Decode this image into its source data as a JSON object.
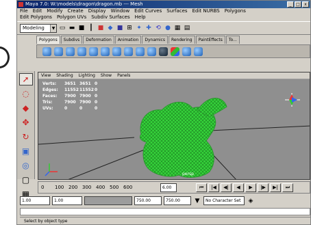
{
  "window": {
    "title": "Maya 7.0: W:\\models\\dragon\\dragon.mb --- Mesh",
    "min": "_",
    "max": "□",
    "close": "x"
  },
  "menus": {
    "row1": [
      "File",
      "Edit",
      "Modify",
      "Create",
      "Display",
      "Window",
      "Edit Curves",
      "Surfaces",
      "Edit NURBS",
      "Polygons"
    ],
    "row2": [
      "Edit Polygons",
      "Polygon UVs",
      "Subdiv Surfaces",
      "Help"
    ]
  },
  "status": {
    "mode": "Modeling",
    "mode_arrow": "▼"
  },
  "shelf": {
    "tabs": [
      "Polygons",
      "Subdivs",
      "Deformation",
      "Animation",
      "Dynamics",
      "Rendering",
      "PaintEffects",
      "To..."
    ]
  },
  "panel": {
    "menu": [
      "View",
      "Shading",
      "Lighting",
      "Show",
      "Panels"
    ],
    "camera": "persp"
  },
  "hud": {
    "rows": [
      {
        "label": "Verts:",
        "v1": "3651",
        "v2": "3651",
        "v3": "0"
      },
      {
        "label": "Edges:",
        "v1": "11552",
        "v2": "11552",
        "v3": "0"
      },
      {
        "label": "Faces:",
        "v1": "7900",
        "v2": "7900",
        "v3": "0"
      },
      {
        "label": "Tris:",
        "v1": "7900",
        "v2": "7900",
        "v3": "0"
      },
      {
        "label": "UVs:",
        "v1": "0",
        "v2": "0",
        "v3": "0"
      }
    ]
  },
  "axis": {
    "x": "x",
    "y": "y",
    "z": "z"
  },
  "timeline": {
    "ticks": [
      "0",
      "100",
      "200",
      "300",
      "400",
      "500",
      "600"
    ],
    "current": "6.00"
  },
  "range": {
    "start": "1.00",
    "start2": "1.00",
    "end": "750.00",
    "end2": "750.00",
    "character": "No Character Set"
  },
  "help": "Select by object type",
  "colors": {
    "mesh": "#35d23a",
    "viewport": "#8f8f8f",
    "titlebar": "#0a246a"
  }
}
